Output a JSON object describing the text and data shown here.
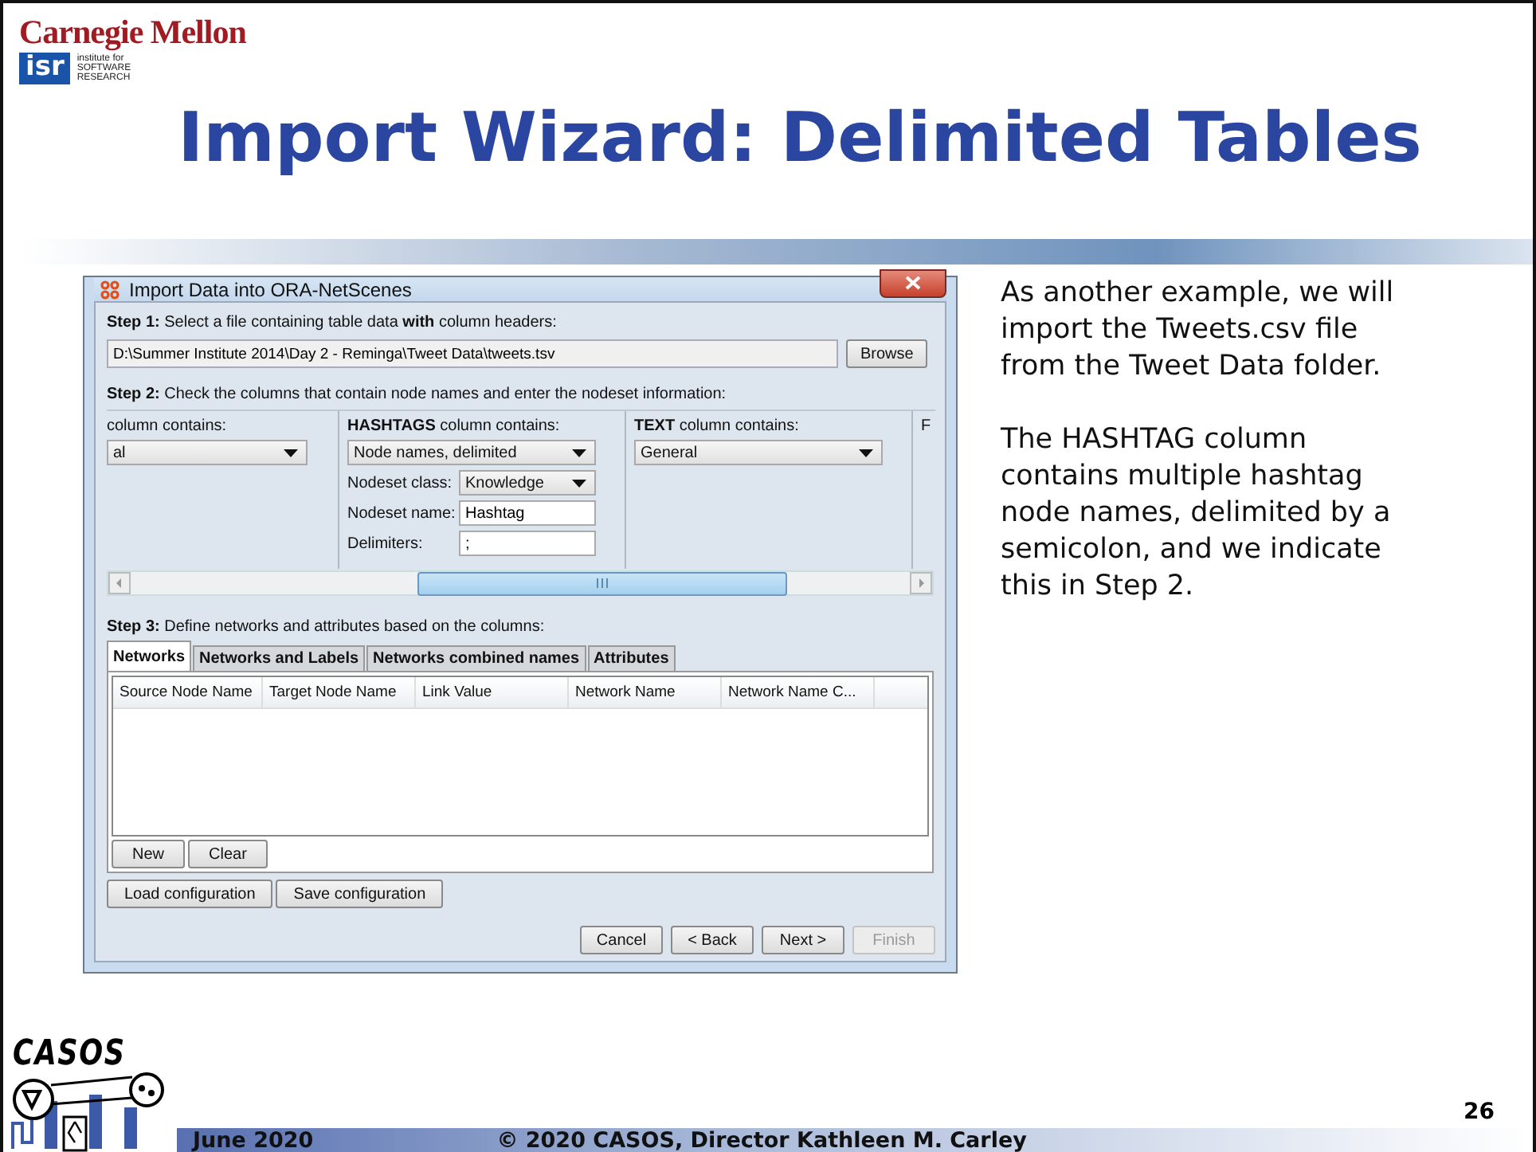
{
  "header": {
    "university": "Carnegie Mellon",
    "institute_mark": "isr",
    "institute_lines": [
      "institute for",
      "SOFTWARE",
      "RESEARCH"
    ]
  },
  "slide_title": "Import Wizard: Delimited Tables",
  "dialog": {
    "title": "Import Data into ORA-NetScenes",
    "step1": "**Step 1:** Select a file containing table data **with** column headers:",
    "file_path": "D:\\Summer Institute 2014\\Day 2 - Reminga\\Tweet Data\\tweets.tsv",
    "browse_button": "Browse",
    "step2": "**Step 2:** Check the columns that contain node names and enter the nodeset information:",
    "columns": [
      {
        "heading": "column contains:",
        "type": "al"
      },
      {
        "heading": "**HASHTAGS** column contains:",
        "type": "Node names, delimited",
        "fields": [
          {
            "label": "Nodeset class:",
            "kind": "dropdown",
            "value": "Knowledge"
          },
          {
            "label": "Nodeset name:",
            "kind": "input",
            "value": "Hashtag"
          },
          {
            "label": "Delimiters:",
            "kind": "input",
            "value": ";"
          }
        ]
      },
      {
        "heading": "**TEXT** column contains:",
        "type": "General"
      },
      {
        "heading": "F"
      }
    ],
    "step3": "**Step 3:** Define networks and attributes based on the columns:",
    "tabs": [
      {
        "label": "Networks",
        "selected": true
      },
      {
        "label": "Networks and Labels",
        "selected": false
      },
      {
        "label": "Networks combined names",
        "selected": false
      },
      {
        "label": "Attributes",
        "selected": false
      }
    ],
    "table_columns": [
      "Source Node Name",
      "Target Node Name",
      "Link Value",
      "Network Name",
      "Network Name C..."
    ],
    "table_buttons": [
      "New",
      "Clear"
    ],
    "config_buttons": [
      "Load configuration",
      "Save configuration"
    ],
    "nav_buttons": [
      {
        "label": "Cancel",
        "disabled": false
      },
      {
        "label": "< Back",
        "disabled": false
      },
      {
        "label": "Next >",
        "disabled": false
      },
      {
        "label": "Finish",
        "disabled": true
      }
    ]
  },
  "notes": [
    "As another example, we will import the Tweets.csv file from the Tweet Data folder.",
    "The HASHTAG column contains multiple hashtag node names, delimited by a semicolon, and we indicate this in Step 2."
  ],
  "footer": {
    "logo_text": "CASOS",
    "date": "June 2020",
    "copyright": "© 2020 CASOS, Director Kathleen M. Carley",
    "page_number": "26"
  }
}
